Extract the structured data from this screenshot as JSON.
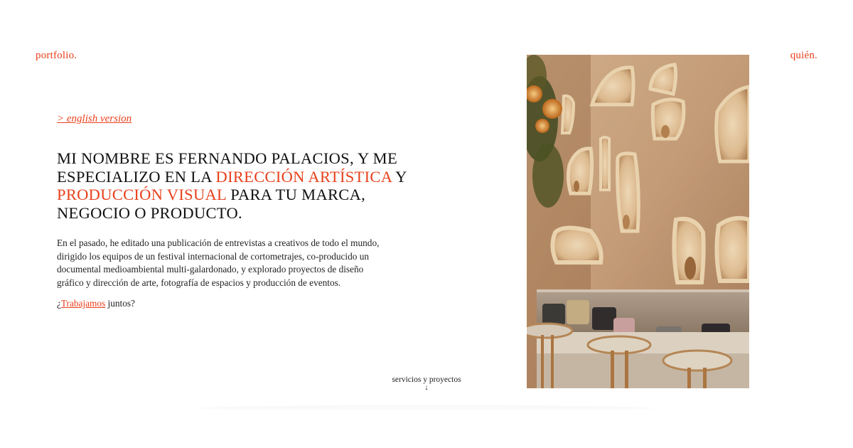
{
  "nav": {
    "portfolio_label": "portfolio.",
    "quien_label": "quién."
  },
  "language_link": "> english version",
  "headline": {
    "part1": "Mi nombre es Fernando Palacios, y me especializo en la ",
    "accent1": "dirección artística",
    "part2": " y ",
    "accent2": "producción visual",
    "part3": " para tu marca, negocio o producto."
  },
  "bio": "En el pasado, he editado una publicación de entrevistas a creativos de todo el mundo, dirigido los equipos de un festival internacional de cortometrajes, co-producido un documental medioambiental multi-galardonado, y explorado proyectos de diseño gráfico y dirección de arte, fotografía de espacios y producción de eventos.",
  "cta": {
    "prefix": "¿",
    "link": "Trabajamos",
    "suffix": " juntos?"
  },
  "scroll_cue": {
    "label": "servicios y proyectos",
    "arrow": "↓"
  },
  "colors": {
    "accent": "#e8401c",
    "text": "#111111",
    "background": "#ffffff"
  }
}
